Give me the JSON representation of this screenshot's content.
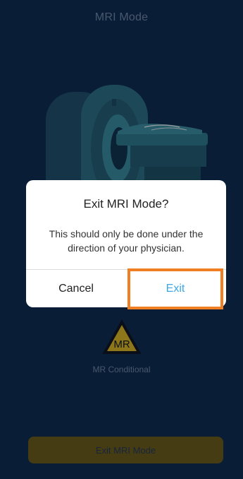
{
  "page": {
    "title": "MRI Mode",
    "mr_badge_text": "MR",
    "mr_caption": "MR Conditional",
    "bottom_button_label": "Exit MRI Mode"
  },
  "dialog": {
    "title": "Exit MRI Mode?",
    "message": "This should only be done under the direction of your physician.",
    "cancel_label": "Cancel",
    "exit_label": "Exit"
  },
  "colors": {
    "background": "#0f2d55",
    "accent_blue": "#3aa7e8",
    "highlight_orange": "#f07f23",
    "badge_yellow": "#d9b728"
  },
  "icons": {
    "illustration": "mri-scanner-illustration",
    "badge": "mr-conditional-triangle-icon"
  }
}
